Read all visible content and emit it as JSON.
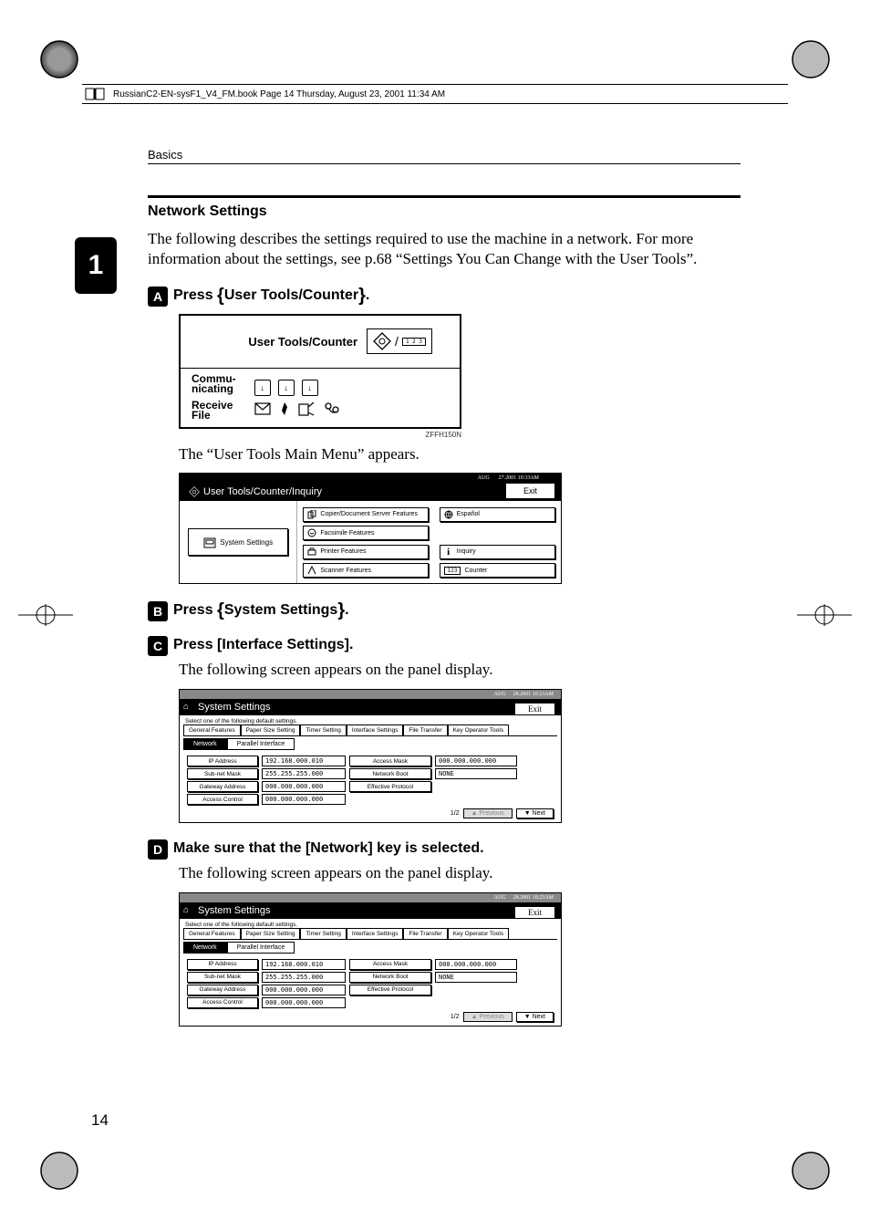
{
  "print_header": "RussianC2-EN-sysF1_V4_FM.book  Page 14  Thursday, August 23, 2001  11:34 AM",
  "running_head": "Basics",
  "chapter_tab": "1",
  "section_title": "Network Settings",
  "intro_paragraph": "The following describes the settings required to use the machine in a network. For more information about the settings, see p.68 “Settings You Can Change with the User Tools”.",
  "steps": {
    "s1": {
      "num": "A",
      "lead": "Press ",
      "key": "User Tools/Counter"
    },
    "s2": {
      "num": "B",
      "lead": "Press ",
      "key": "System Settings"
    },
    "s3": {
      "num": "C",
      "lead": "Press ",
      "key": "[Interface Settings]"
    },
    "s4": {
      "num": "D",
      "lead": "Make sure that the ",
      "key": "[Network]",
      "trail": " key is selected."
    }
  },
  "after_step1": "The “User Tools Main Menu” appears.",
  "after_step3": "The following screen appears on the panel display.",
  "after_step4": "The following screen appears on the panel display.",
  "panel1": {
    "label_top": "User Tools/Counter",
    "counter_chip": "1 2 3",
    "left_col": {
      "communicating_l1": "Commu-",
      "communicating_l2": "nicating",
      "receive_l1": "Receive",
      "receive_l2": "File"
    },
    "code": "ZFFH150N"
  },
  "menu": {
    "title": "User Tools/Counter/Inquiry",
    "exit": "Exit",
    "left_btn": "System Settings",
    "mid": [
      "Copier/Document Server Features",
      "Facsimile Features",
      "Printer Features",
      "Scanner Features"
    ],
    "right": [
      "Español",
      "Inquiry",
      "Counter"
    ]
  },
  "settings": {
    "title": "System Settings",
    "exit": "Exit",
    "sub": "Select one of the following default settings.",
    "tabs": [
      "General Features",
      "Paper Size Setting",
      "Timer Setting",
      "Interface Settings",
      "File Transfer",
      "Key Operator Tools"
    ],
    "subtabs": {
      "active": "Network",
      "other": "Parallel Interface"
    },
    "rows": [
      {
        "label": "IP Address",
        "val": "192.168.000.010",
        "label2": "Access Mask",
        "val2": "000.000.000.000"
      },
      {
        "label": "Sub-net Mask",
        "val": "255.255.255.000",
        "label2": "Network Boot",
        "val2": "NONE"
      },
      {
        "label": "Gateway Address",
        "val": "000.000.000.000",
        "label2": "Effective Protocol",
        "val2": ""
      },
      {
        "label": "Access Control",
        "val": "000.000.000.000",
        "label2": "",
        "val2": ""
      }
    ],
    "pager": {
      "pos": "1/2",
      "prev": "▲ Previous",
      "next": "▼ Next"
    }
  },
  "page_number": "14"
}
